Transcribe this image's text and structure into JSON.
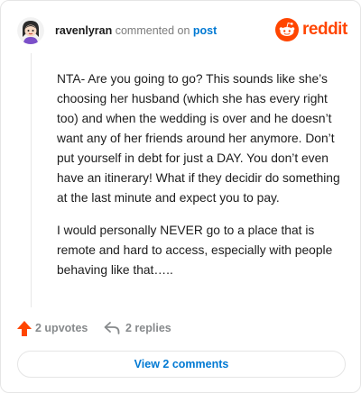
{
  "comment": {
    "username": "ravenlyran",
    "action_text": "commented on",
    "post_link": "post",
    "avatar_icon": "avatar-icon",
    "paragraphs": [
      "NTA- Are you going to go? This sounds like she’s choosing her husband (which she has every right too) and when the wedding is over and he doesn’t want any of her friends around her anymore. Don’t put yourself in debt for just a DAY. You don’t even have an itinerary! What if they decidir do something at the last minute and expect you to pay.",
      "I would personally NEVER go to a place that is remote and hard to access, especially with people behaving like that….."
    ]
  },
  "brand": {
    "wordmark": "reddit",
    "icon": "reddit-snoo-icon",
    "color": "#ff4500"
  },
  "actions": {
    "upvotes_label": "2 upvotes",
    "replies_label": "2 replies",
    "upvote_color": "#ff4500"
  },
  "footer": {
    "view_label": "View 2 comments"
  },
  "colors": {
    "link": "#0079d3",
    "muted": "#7c7c7c",
    "border": "#e5e5e5"
  }
}
